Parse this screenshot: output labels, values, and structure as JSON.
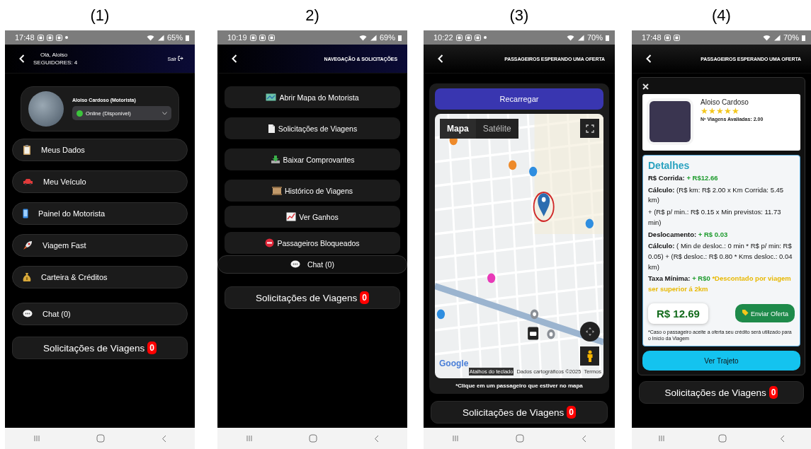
{
  "panels": [
    {
      "caption": "(1)",
      "kind": "profile",
      "status_bar": {
        "time": "17:48",
        "battery": "65%"
      },
      "header": {
        "greeting": "Olá, Aloiso",
        "followers": "SEGUIDORES: 4",
        "action": "Sair"
      },
      "profile": {
        "name": "Aloiso Cardoso (Motorista)",
        "status": "Online (Disponível)"
      },
      "menu": [
        "Meus Dados",
        "Meu Veículo",
        "Painel do Motorista",
        "Viagem Fast",
        "Carteira & Créditos"
      ],
      "chat": "Chat (0)",
      "requests": {
        "label": "Solicitações de Viagens",
        "count": "0"
      }
    },
    {
      "caption": "2)",
      "kind": "menu",
      "status_bar": {
        "time": "10:19",
        "battery": "69%"
      },
      "header": {
        "title": "NAVEGAÇÃO & SOLICITAÇÕES"
      },
      "menu": [
        "Abrir Mapa do Motorista",
        "Solicitações de Viagens",
        "Baixar Comprovantes",
        "Histórico de Viagens",
        "Ver Ganhos",
        "Passageiros Bloqueados"
      ],
      "chat": "Chat (0)",
      "requests": {
        "label": "Solicitações de Viagens",
        "count": "0"
      }
    },
    {
      "caption": "(3)",
      "kind": "map",
      "status_bar": {
        "time": "10:22",
        "battery": "70%"
      },
      "header": {
        "title": "PASSAGEIROS ESPERANDO UMA OFERTA"
      },
      "reload": "Recarregar",
      "map": {
        "types": [
          {
            "label": "Mapa",
            "selected": true
          },
          {
            "label": "Satélite",
            "selected": false
          }
        ],
        "logo": "Google",
        "shortcuts": "Atalhos do teclado",
        "attribution": "Dados cartográficos ©2025",
        "terms": "Termos"
      },
      "hint": "*Clique em um passageiro que estiver no mapa",
      "requests": {
        "label": "Solicitações de Viagens",
        "count": "0"
      }
    },
    {
      "caption": "(4)",
      "kind": "offer",
      "status_bar": {
        "time": "17:48",
        "battery": "70%"
      },
      "header": {
        "title": "PASSAGEIROS ESPERANDO UMA OFERTA"
      },
      "passenger": {
        "name": "Aloiso Cardoso",
        "stars": 5,
        "trips": "Nº Viagens Avaliadas: 2.00"
      },
      "details": {
        "title": "Detalhes",
        "lines": [
          {
            "label": "R$ Corrida:",
            "value": "+ R$12.66"
          },
          {
            "label": "Cálculo:",
            "text": "(R$ km: R$ 2.00 x Km Corrida: 5.45 km)"
          },
          {
            "text": "+ (R$ p/ min.: R$ 0.15 x Min previstos: 11.73 min)"
          },
          {
            "label": "Deslocamento:",
            "value": "+ R$ 0.03"
          },
          {
            "label": "Cálculo:",
            "text": "( Min de desloc.: 0 min * R$ p/ min: R$ 0.05) + (R$ desloc.: R$ 0.80 * Kms desloc.: 0.04 km)"
          },
          {
            "label": "Taxa Mínima:",
            "value": "+ R$0",
            "note": "*Descontado por viagem ser superior á 2km"
          }
        ]
      },
      "price": "R$ 12.69",
      "send": "Enviar Oferta",
      "footnote": "*Caso o passageiro aceite a oferta seu crédito será utilizado para o Início da Viagem",
      "route": "Ver Trajeto",
      "requests": {
        "label": "Solicitações de Viagens",
        "count": "0"
      }
    }
  ]
}
